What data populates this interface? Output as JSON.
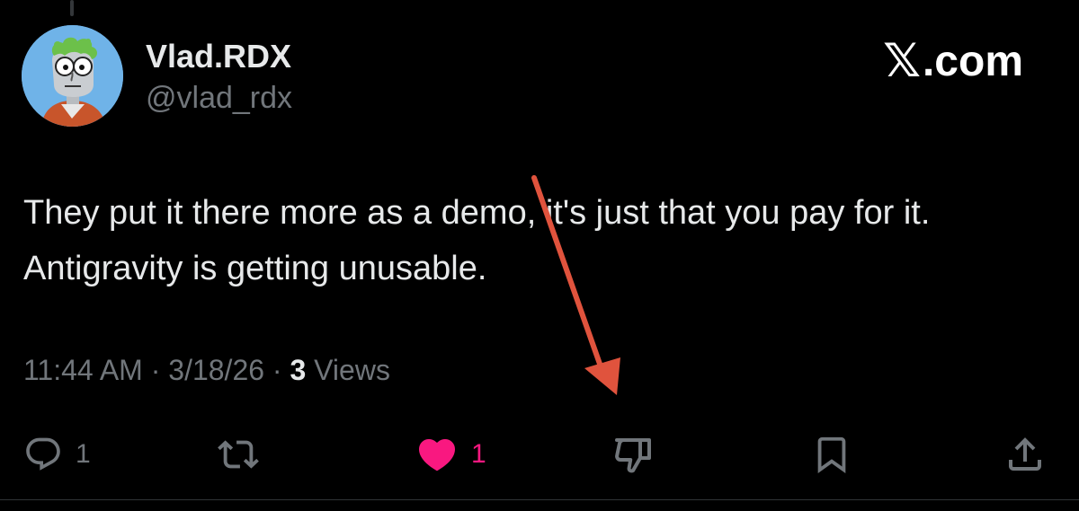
{
  "author": {
    "display_name": "Vlad.RDX",
    "handle": "@vlad_rdx",
    "avatar_icon": "cartoon-character-avatar"
  },
  "brand": {
    "label": ".com",
    "icon": "x-logo-icon"
  },
  "tweet": {
    "text": "They put it there more as a demo, it's just that you pay for it. Antigravity is getting unusable."
  },
  "meta": {
    "time": "11:44 AM",
    "separator": "·",
    "date": "3/18/26",
    "views_count": "3",
    "views_label": "Views"
  },
  "actions": {
    "reply_count": "1",
    "like_count": "1",
    "like_color": "#f91880",
    "icon_color": "#71767b"
  },
  "annotation": {
    "arrow_color": "#e0533d"
  }
}
